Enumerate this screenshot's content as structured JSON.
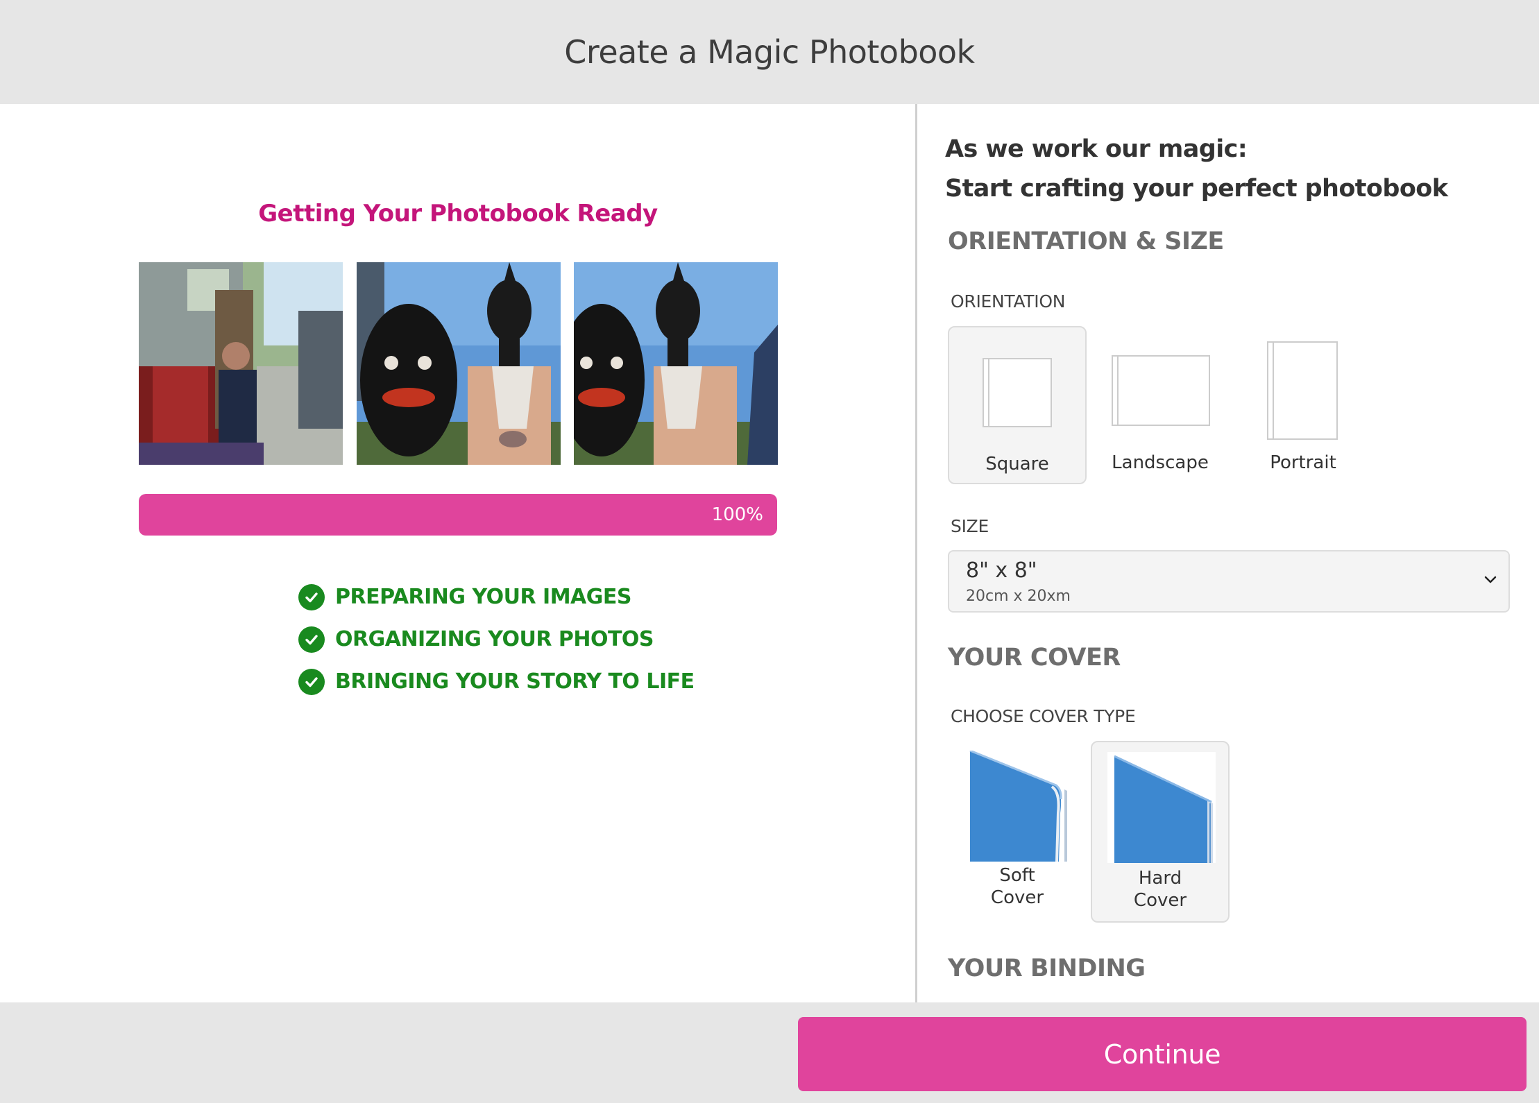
{
  "header": {
    "title": "Create a Magic Photobook"
  },
  "left": {
    "title": "Getting Your Photobook Ready",
    "photos": [
      {
        "icon": "photo-van-child"
      },
      {
        "icon": "photo-masks-1"
      },
      {
        "icon": "photo-masks-2"
      }
    ],
    "progress": {
      "value": 100,
      "label": "100%"
    },
    "steps": [
      {
        "label": "PREPARING YOUR IMAGES",
        "icon": "check-circle-icon"
      },
      {
        "label": "ORGANIZING YOUR PHOTOS",
        "icon": "check-circle-icon"
      },
      {
        "label": "BRINGING YOUR STORY TO LIFE",
        "icon": "check-circle-icon"
      }
    ]
  },
  "right": {
    "intro_line1": "As we work our magic:",
    "intro_line2": "Start crafting your perfect photobook",
    "orientation_section": "ORIENTATION & SIZE",
    "orientation_label": "ORIENTATION",
    "orientations": [
      {
        "label": "Square",
        "selected": true
      },
      {
        "label": "Landscape",
        "selected": false
      },
      {
        "label": "Portrait",
        "selected": false
      }
    ],
    "size_label": "SIZE",
    "size": {
      "value": "8\" x 8\"",
      "sub": "20cm x 20xm"
    },
    "cover_section": "YOUR COVER",
    "cover_type_label": "CHOOSE COVER TYPE",
    "covers": [
      {
        "line1": "Soft",
        "line2": "Cover",
        "selected": false
      },
      {
        "line1": "Hard",
        "line2": "Cover",
        "selected": true
      }
    ],
    "binding_section": "YOUR BINDING"
  },
  "footer": {
    "continue_label": "Continue"
  },
  "colors": {
    "accent": "#e0449c",
    "title_pink": "#c4157a",
    "success": "#1a8a1f",
    "chrome": "#e6e6e6"
  }
}
